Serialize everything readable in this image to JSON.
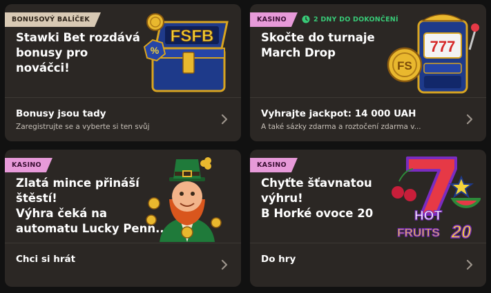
{
  "cards": [
    {
      "badge": "BONUSOVÝ BALÍČEK",
      "title_lines": [
        "Stawki Bet rozdává",
        "bonusy pro",
        "nováčci!"
      ],
      "footer_title": "Bonusy jsou tady",
      "footer_subtitle": "Zaregistrujte se a vyberte si ten svůj",
      "art": "treasure-chest-fsfb-icon",
      "art_text": "FSFB",
      "colors": {
        "badge_bg": "#d8c9b4"
      }
    },
    {
      "badge": "KASINO",
      "timer": "2 DNY DO DOKONČENÍ",
      "title_lines": [
        "Skočte do turnaje",
        "March Drop"
      ],
      "footer_title": "Vyhrajte jackpot: 14 000 UAH",
      "footer_subtitle": "A také sázky zdarma a roztočení zdarma v...",
      "art": "slot-machine-icon",
      "art_text": "777",
      "colors": {
        "badge_bg": "#e79ad9",
        "timer": "#38c977"
      }
    },
    {
      "badge": "KASINO",
      "title_lines": [
        "Zlatá mince přináší",
        "štěstí!",
        "Výhra čeká na",
        "automatu Lucky Penn..."
      ],
      "footer_title": "Chci si hrát",
      "art": "leprechaun-icon",
      "colors": {
        "badge_bg": "#e79ad9"
      }
    },
    {
      "badge": "KASINO",
      "title_lines": [
        "Chyťte šťavnatou",
        "výhru!",
        "B Horké ovoce 20"
      ],
      "footer_title": "Do hry",
      "art": "hot-fruits-20-logo",
      "art_text_1": "HOT",
      "art_text_2": "FRUITS",
      "art_text_3": "20",
      "colors": {
        "badge_bg": "#e79ad9"
      }
    }
  ]
}
